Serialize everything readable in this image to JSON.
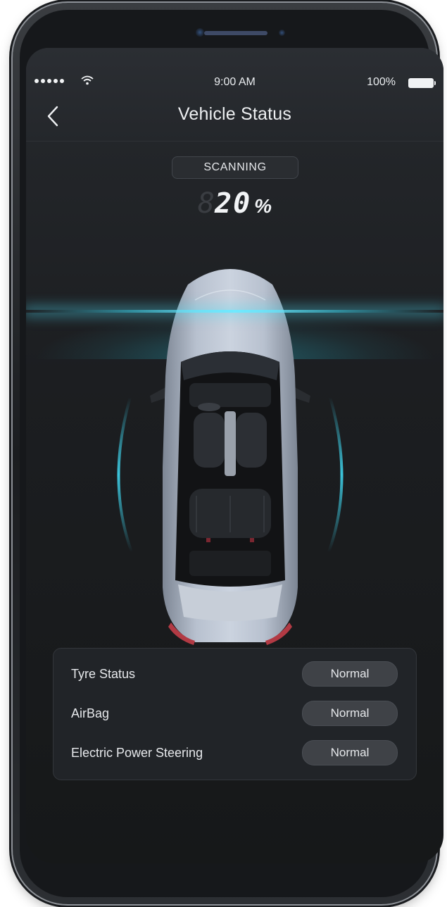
{
  "status_bar": {
    "time": "9:00 AM",
    "battery": "100%",
    "signal_icon": "signal-dots-icon",
    "wifi_icon": "wifi-icon",
    "battery_icon": "battery-icon"
  },
  "header": {
    "title": "Vehicle Status",
    "back_icon": "chevron-left-icon"
  },
  "scan": {
    "label": "SCANNING",
    "ghost_digit": "8",
    "progress_value": "20",
    "progress_unit": "%",
    "progress_percent": 20
  },
  "vehicle_icon": "car-top-view-icon",
  "checks": [
    {
      "label": "Tyre Status",
      "status": "Normal"
    },
    {
      "label": "AirBag",
      "status": "Normal"
    },
    {
      "label": "Electric Power Steering",
      "status": "Normal"
    }
  ],
  "colors": {
    "accent": "#3fd6ef",
    "background": "#1c1e21",
    "panel": "#212428",
    "badge": "#3f4247"
  }
}
